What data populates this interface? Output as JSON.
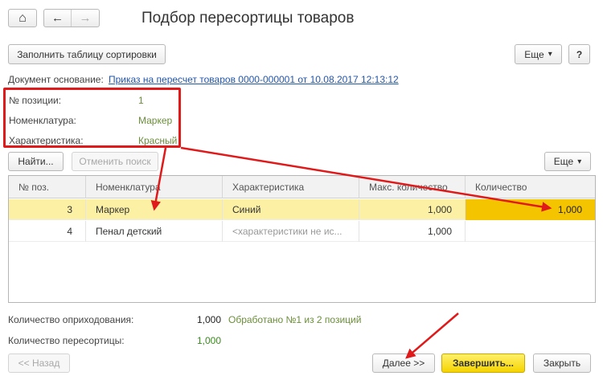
{
  "window": {
    "title": "Подбор пересортицы товаров"
  },
  "nav": {
    "home_icon": "home-icon",
    "back_icon": "arrow-left-icon",
    "forward_icon": "arrow-right-icon",
    "home_glyph": "⌂",
    "back_glyph": "←",
    "forward_glyph": "→"
  },
  "toolbar": {
    "fill_table_label": "Заполнить таблицу сортировки",
    "more_label": "Еще",
    "more_arrow": "▾",
    "help_label": "?"
  },
  "base_document": {
    "label": "Документ основание:",
    "link": "Приказ на пересчет товаров 0000-000001 от 10.08.2017 12:13:12"
  },
  "details": {
    "position_label": "№ позиции:",
    "position_value": "1",
    "nomenclature_label": "Номенклатура:",
    "nomenclature_value": "Маркер",
    "characteristic_label": "Характеристика:",
    "characteristic_value": "Красный"
  },
  "table_toolbar": {
    "find_label": "Найти...",
    "cancel_search_label": "Отменить поиск",
    "more_label": "Еще",
    "more_arrow": "▾"
  },
  "table": {
    "columns": [
      "№ поз.",
      "Номенклатура",
      "Характеристика",
      "Макс. количество",
      "Количество"
    ],
    "rows": [
      {
        "pos": "3",
        "nomenclature": "Маркер",
        "characteristic": "Синий",
        "max_qty": "1,000",
        "qty": "1,000",
        "selected": true
      },
      {
        "pos": "4",
        "nomenclature": "Пенал детский",
        "characteristic": "<характеристики не ис...",
        "max_qty": "1,000",
        "qty": "",
        "selected": false
      }
    ]
  },
  "summary": {
    "received_label": "Количество оприходования:",
    "received_value": "1,000",
    "processed_text": "Обработано №1 из 2 позиций",
    "regrading_label": "Количество пересортицы:",
    "regrading_value": "1,000"
  },
  "footer": {
    "back_label": "<< Назад",
    "next_label": "Далее >>",
    "finish_label": "Завершить...",
    "close_label": "Закрыть"
  },
  "colors": {
    "annotation_red": "#e0191a",
    "selected_row": "#fbf0a4",
    "active_cell": "#f5c400",
    "green_value": "#6b8e3a",
    "link_blue": "#2255aa"
  }
}
